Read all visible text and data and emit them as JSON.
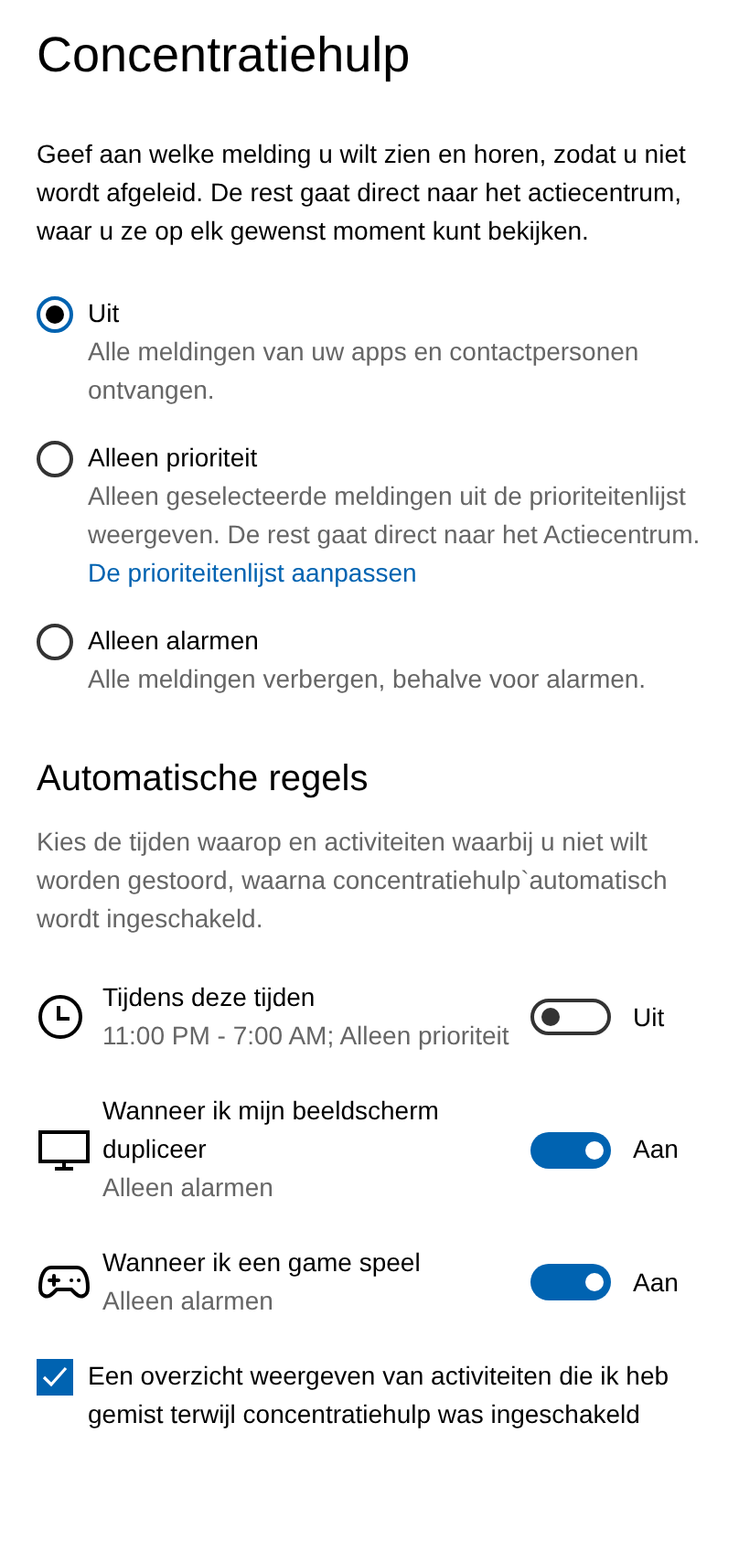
{
  "title": "Concentratiehulp",
  "intro": "Geef aan welke melding u wilt zien en horen, zodat u niet wordt afgeleid. De rest gaat direct naar het actiecentrum, waar u ze op elk gewenst moment kunt bekijken.",
  "modes": [
    {
      "label": "Uit",
      "description": "Alle meldingen van uw apps en contactpersonen ontvangen.",
      "selected": true
    },
    {
      "label": "Alleen prioriteit",
      "description": "Alleen geselecteerde meldingen uit de prioriteitenlijst weergeven. De rest gaat direct naar het Actiecentrum.",
      "link": "De prioriteitenlijst aanpassen",
      "selected": false
    },
    {
      "label": "Alleen alarmen",
      "description": "Alle meldingen verbergen, behalve voor alarmen.",
      "selected": false
    }
  ],
  "rules_heading": "Automatische regels",
  "rules_intro": "Kies de tijden waarop en activiteiten waarbij u niet wilt worden gestoord, waarna concentratiehulp`automatisch wordt ingeschakeld.",
  "rules": [
    {
      "kind": "clock",
      "title": "Tijdens deze tijden",
      "subtitle": "11:00 PM - 7:00 AM; Alleen prioriteit",
      "on": false,
      "status": "Uit"
    },
    {
      "kind": "monitor",
      "title": "Wanneer ik mijn beeldscherm dupliceer",
      "subtitle": "Alleen alarmen",
      "on": true,
      "status": "Aan"
    },
    {
      "kind": "gamepad",
      "title": "Wanneer ik een game speel",
      "subtitle": "Alleen alarmen",
      "on": true,
      "status": "Aan"
    }
  ],
  "summary": {
    "label": "Een overzicht weergeven van activiteiten die ik heb gemist terwijl concentratiehulp was ingeschakeld",
    "checked": true
  }
}
